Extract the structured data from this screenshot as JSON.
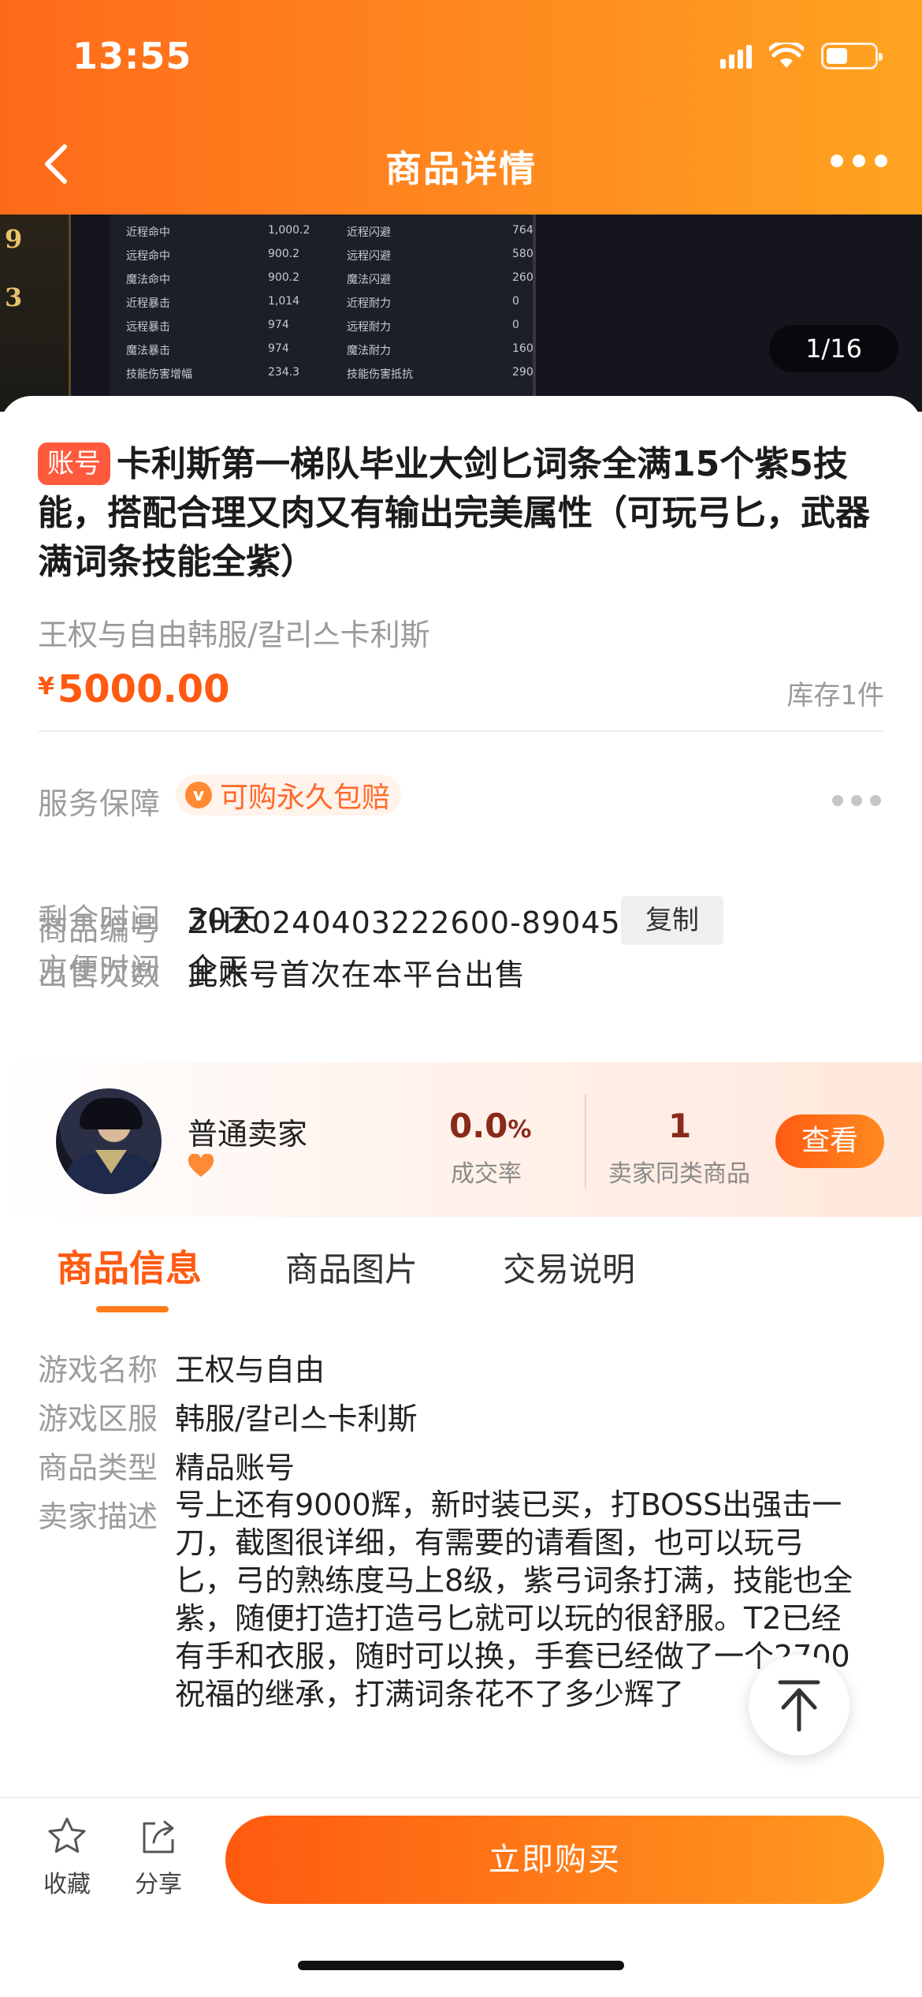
{
  "status_bar": {
    "time": "13:55"
  },
  "nav": {
    "title": "商品详情"
  },
  "gallery": {
    "counter": "1/16",
    "left_values": [
      "9",
      "3"
    ],
    "stats": [
      {
        "a": "近程命中",
        "b": "1,000.2",
        "c": "近程闪避",
        "d": "764"
      },
      {
        "a": "远程命中",
        "b": "900.2",
        "c": "远程闪避",
        "d": "580"
      },
      {
        "a": "魔法命中",
        "b": "900.2",
        "c": "魔法闪避",
        "d": "260"
      },
      {
        "a": "近程暴击",
        "b": "1,014",
        "c": "近程耐力",
        "d": "0"
      },
      {
        "a": "远程暴击",
        "b": "974",
        "c": "远程耐力",
        "d": "0"
      },
      {
        "a": "魔法暴击",
        "b": "974",
        "c": "魔法耐力",
        "d": "160"
      },
      {
        "a": "技能伤害增幅",
        "b": "234.3",
        "c": "技能伤害抵抗",
        "d": "290"
      }
    ]
  },
  "product": {
    "tag": "账号",
    "title": "卡利斯第一梯队毕业大剑匕词条全满15个紫5技能，搭配合理又肉又有输出完美属性（可玩弓匕，武器满词条技能全紫）",
    "server": "王权与自由韩服/칼리스卡利斯",
    "currency": "¥",
    "price": "5000.00",
    "stock": "库存1件"
  },
  "info": {
    "guarantee_label": "服务保障",
    "guarantee_value": "可购永久包赔",
    "guarantee_icon": "v",
    "code_label": "商品编号",
    "code_value": "ZH20240403222600-89045",
    "copy_label": "复制",
    "time_label": "方便时间",
    "time_value": "全天",
    "remain_label": "剩余时间",
    "remain_value": "30天",
    "sales_label": "出售次数",
    "sales_value": "此账号首次在本平台出售"
  },
  "seller": {
    "name": "普通卖家",
    "rate_value": "0.0",
    "rate_unit": "%",
    "rate_label": "成交率",
    "count_value": "1",
    "count_label": "卖家同类商品",
    "view_label": "查看"
  },
  "tabs": [
    "商品信息",
    "商品图片",
    "交易说明"
  ],
  "details": {
    "game_label": "游戏名称",
    "game_value": "王权与自由",
    "server_label": "游戏区服",
    "server_value": "韩服/칼리스卡利斯",
    "type_label": "商品类型",
    "type_value": "精品账号",
    "desc_label": "卖家描述",
    "desc_value": "号上还有9000辉，新时装已买，打BOSS出强击一刀，截图很详细，有需要的请看图，也可以玩弓匕，弓的熟练度马上8级，紫弓词条打满，技能也全紫，随便打造打造弓匕就可以玩的很舒服。T2已经有手和衣服，随时可以换，手套已经做了一个2700祝福的继承，打满词条花不了多少辉了"
  },
  "bottom_bar": {
    "favorite_label": "收藏",
    "share_label": "分享",
    "buy_label": "立即购买"
  },
  "colors": {
    "accent": "#ff6a1a",
    "price": "#ff5a12",
    "tag": "#ff5a3d"
  }
}
